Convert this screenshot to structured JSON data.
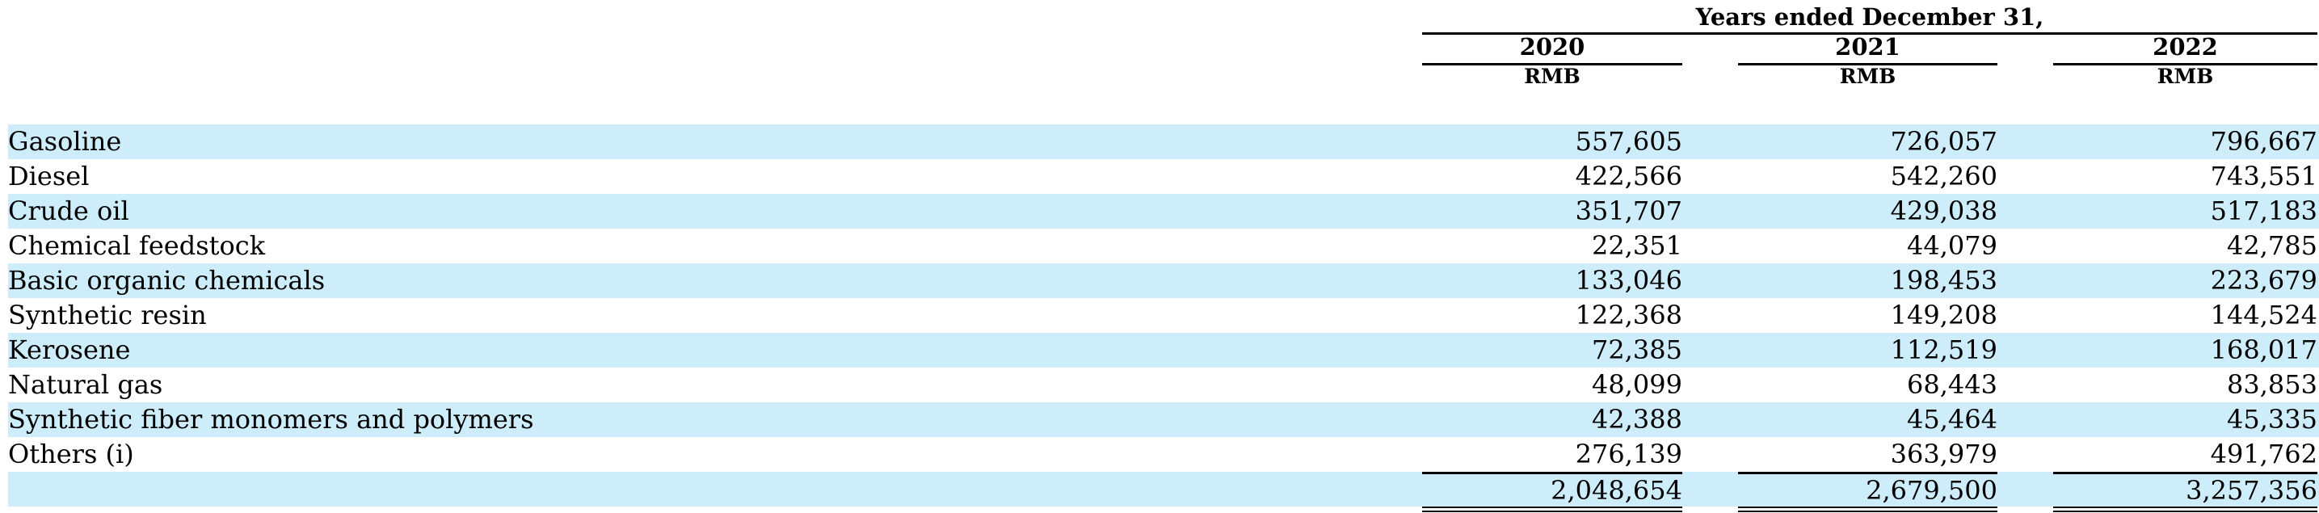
{
  "header": {
    "group_label": "Years ended December 31,",
    "years": [
      "2020",
      "2021",
      "2022"
    ],
    "units": [
      "RMB",
      "RMB",
      "RMB"
    ]
  },
  "rows": [
    {
      "label": "Gasoline",
      "values": [
        "557,605",
        "726,057",
        "796,667"
      ]
    },
    {
      "label": "Diesel",
      "values": [
        "422,566",
        "542,260",
        "743,551"
      ]
    },
    {
      "label": "Crude oil",
      "values": [
        "351,707",
        "429,038",
        "517,183"
      ]
    },
    {
      "label": "Chemical feedstock",
      "values": [
        "22,351",
        "44,079",
        "42,785"
      ]
    },
    {
      "label": "Basic organic chemicals",
      "values": [
        "133,046",
        "198,453",
        "223,679"
      ]
    },
    {
      "label": "Synthetic resin",
      "values": [
        "122,368",
        "149,208",
        "144,524"
      ]
    },
    {
      "label": "Kerosene",
      "values": [
        "72,385",
        "112,519",
        "168,017"
      ]
    },
    {
      "label": "Natural gas",
      "values": [
        "48,099",
        "68,443",
        "83,853"
      ]
    },
    {
      "label": "Synthetic fiber monomers and polymers",
      "values": [
        "42,388",
        "45,464",
        "45,335"
      ]
    },
    {
      "label": "Others (i)",
      "values": [
        "276,139",
        "363,979",
        "491,762"
      ]
    }
  ],
  "total": {
    "label": "",
    "values": [
      "2,048,654",
      "2,679,500",
      "3,257,356"
    ]
  },
  "colors": {
    "row_shade": "#cdedfa",
    "text": "#000000"
  }
}
